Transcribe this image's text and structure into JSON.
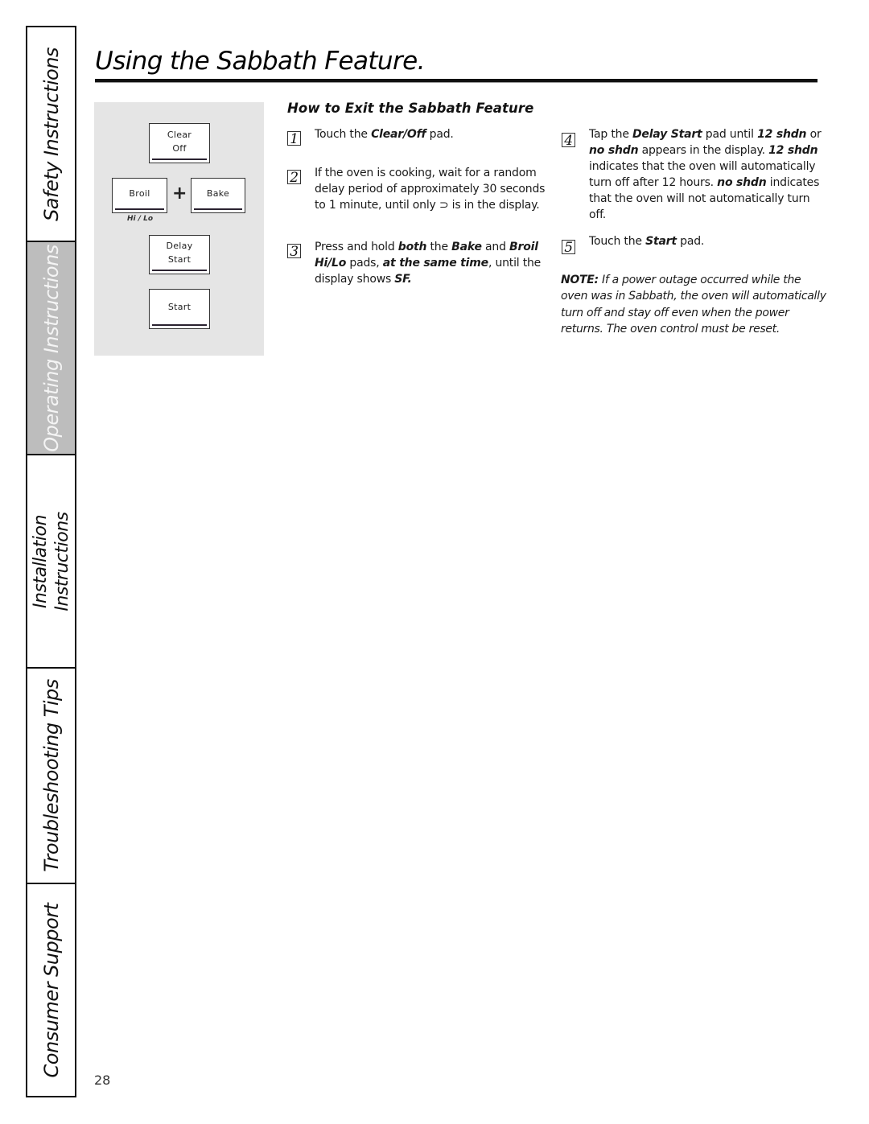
{
  "side_tabs": [
    {
      "label": "Safety Instructions",
      "active": false
    },
    {
      "label": "Operating Instructions",
      "active": true
    },
    {
      "label_lines": [
        "Installation",
        "Instructions"
      ],
      "active": false
    },
    {
      "label": "Troubleshooting Tips",
      "active": false
    },
    {
      "label": "Consumer Support",
      "active": false
    }
  ],
  "page_title": "Using the Sabbath Feature.",
  "control_panel": {
    "clear_off": [
      "Clear",
      "Off"
    ],
    "broil": "Broil",
    "plus": "+",
    "bake": "Bake",
    "hi_lo": "Hi / Lo",
    "delay_start": [
      "Delay",
      "Start"
    ],
    "start": "Start"
  },
  "section": {
    "heading": "How to Exit the Sabbath Feature",
    "steps": [
      {
        "number": "1",
        "parts": [
          {
            "t": "Touch the "
          },
          {
            "t": "Clear/Off",
            "b": true
          },
          {
            "t": " pad."
          }
        ]
      },
      {
        "number": "2",
        "parts": [
          {
            "t": "If the oven is cooking, wait for a random delay period of approximately 30 seconds to 1 minute, until only ⊃ is in the display."
          }
        ]
      },
      {
        "number": "3",
        "parts": [
          {
            "t": "Press and hold "
          },
          {
            "t": "both",
            "b": true
          },
          {
            "t": " the "
          },
          {
            "t": "Bake",
            "b": true
          },
          {
            "t": " and "
          },
          {
            "t": "Broil Hi/Lo",
            "b": true
          },
          {
            "t": " pads, "
          },
          {
            "t": "at the same time",
            "b": true
          },
          {
            "t": ", until the display shows "
          },
          {
            "t": "SF.",
            "b": true
          }
        ]
      },
      {
        "number": "4",
        "parts": [
          {
            "t": "Tap the "
          },
          {
            "t": "Delay Start",
            "b": true
          },
          {
            "t": "  pad until "
          },
          {
            "t": "12 shdn",
            "b": true
          },
          {
            "t": " or "
          },
          {
            "t": "no shdn",
            "b": true
          },
          {
            "t": " appears in the display. "
          },
          {
            "t": "12 shdn",
            "b": true
          },
          {
            "t": " indicates that the oven will automatically turn off after 12 hours. "
          },
          {
            "t": "no shdn",
            "b": true
          },
          {
            "t": " indicates that the oven will not automatically turn off."
          }
        ]
      },
      {
        "number": "5",
        "parts": [
          {
            "t": "Touch the "
          },
          {
            "t": "Start",
            "b": true
          },
          {
            "t": "  pad."
          }
        ]
      }
    ],
    "note_label": "NOTE:",
    "note_text": " If a power outage occurred while the oven was in Sabbath, the oven will automatically turn off and stay off even when the power returns. The oven control must be reset."
  },
  "page_number": "28"
}
